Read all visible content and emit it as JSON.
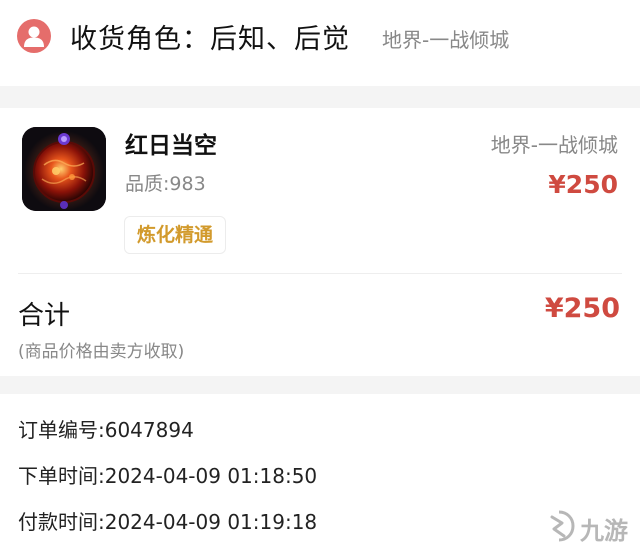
{
  "recipient": {
    "label": "收货角色：后知、后觉",
    "server": "地界-一战倾城",
    "avatar_icon": "user-icon"
  },
  "product": {
    "name": "红日当空",
    "quality": "品质:983",
    "tag": "炼化精通",
    "server": "地界-一战倾城",
    "price": "¥250"
  },
  "total": {
    "label": "合计",
    "note": "(商品价格由卖方收取)",
    "price": "¥250"
  },
  "order": {
    "number": "订单编号:6047894",
    "order_time": "下单时间:2024-04-09 01:18:50",
    "pay_time": "付款时间:2024-04-09 01:19:18"
  },
  "watermark": {
    "text": "九游",
    "icon": "jiuyou-logo-icon"
  },
  "colors": {
    "accent_red": "#cf4a40",
    "avatar_bg": "#e56d6b",
    "tag_gold": "#d29a2c"
  }
}
